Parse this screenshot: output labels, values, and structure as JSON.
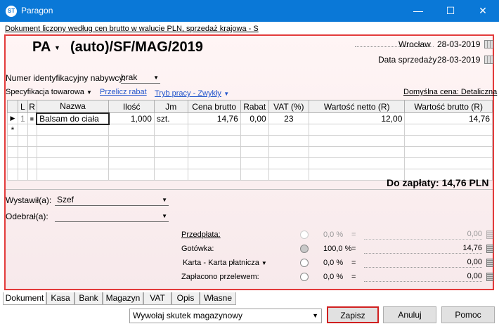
{
  "window": {
    "title": "Paragon",
    "icon_text": "ST",
    "minimize": "—",
    "maximize": "☐",
    "close": "✕"
  },
  "document_info": "Dokument liczony według cen brutto w walucie PLN, sprzedaż krajowa - S",
  "header": {
    "doc_type": "PA",
    "doc_number": "(auto)/SF/MAG/2019",
    "place": "Wrocław",
    "place_date": "28-03-2019",
    "sale_date_label": "Data sprzedaży",
    "sale_date": "28-03-2019"
  },
  "buyer": {
    "label": "Numer identyfikacyjny nabywcy:",
    "value": "brak"
  },
  "toolbar": {
    "spec": "Specyfikacja towarowa",
    "recalc": "Przelicz rabat",
    "mode": "Tryb pracy - Zwykły",
    "default_price": "Domyślna cena: Detaliczna"
  },
  "table": {
    "columns": [
      "",
      "L",
      "R",
      "Nazwa",
      "Ilość",
      "Jm",
      "Cena brutto",
      "Rabat",
      "VAT (%)",
      "Wartość netto (R)",
      "Wartość brutto (R)"
    ],
    "rows": [
      {
        "marker": "▶",
        "lp": "1",
        "r": "■",
        "name": "Balsam do ciała",
        "qty": "1,000",
        "unit": "szt.",
        "price": "14,76",
        "discount": "0,00",
        "vat": "23",
        "net": "12,00",
        "gross": "14,76"
      }
    ],
    "new_row_marker": "*"
  },
  "to_pay": {
    "label": "Do zapłaty:",
    "value": "14,76 PLN"
  },
  "issuer": {
    "label": "Wystawił(a):",
    "value": "Szef"
  },
  "receiver": {
    "label": "Odebrał(a):",
    "value": ""
  },
  "payments": [
    {
      "label": "Przedpłata:",
      "percent": "0,0 %",
      "amount": "0,00",
      "selected": false
    },
    {
      "label": "Gotówka:",
      "percent": "100,0 %",
      "amount": "14,76",
      "selected": true
    },
    {
      "label": "Karta - Karta płatnicza",
      "percent": "0,0 %",
      "amount": "0,00",
      "selected": false
    },
    {
      "label": "Zapłacono przelewem:",
      "percent": "0,0 %",
      "amount": "0,00",
      "selected": false
    }
  ],
  "eq": "=",
  "tabs": [
    "Dokument",
    "Kasa",
    "Bank",
    "Magazyn",
    "VAT",
    "Opis",
    "Własne"
  ],
  "bottom": {
    "effect": "Wywołaj skutek magazynowy",
    "save": "Zapisz",
    "cancel": "Anuluj",
    "help": "Pomoc"
  },
  "colors": {
    "titlebar": "#0a78d7",
    "highlight": "#e33b3b",
    "link": "#2255cc"
  }
}
